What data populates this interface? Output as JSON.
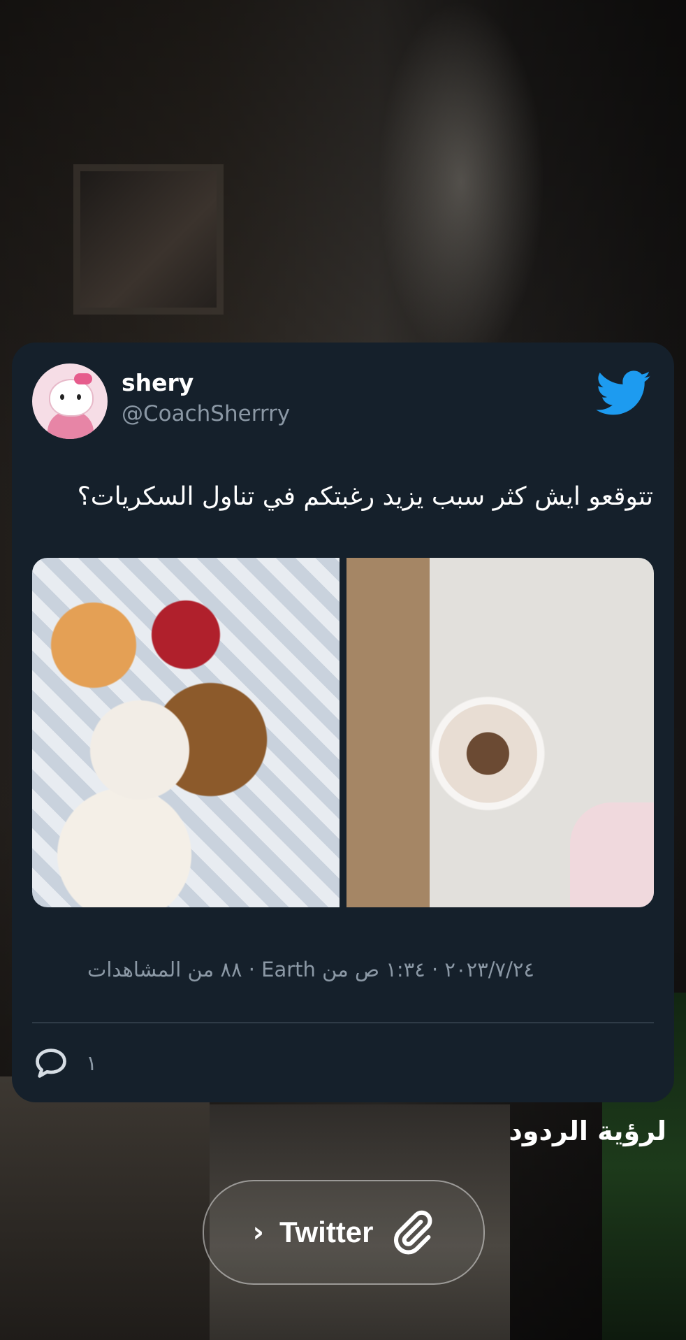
{
  "tweet": {
    "author_name": "shery",
    "author_handle": "@CoachSherrry",
    "text": "تتوقعو ايش كثر سبب يزيد رغبتكم في تناول السكريات؟",
    "meta": "٢٠٢٣/٧/٢٤ · ١:٣٤ ص من Earth · ٨٨ من المشاهدات",
    "reply_count": "١",
    "brand_icon": "twitter-bird-icon",
    "colors": {
      "card_bg": "#15202b",
      "twitter_blue": "#1d9bf0",
      "muted": "#8b98a5"
    }
  },
  "cta": {
    "see_replies": "لرؤية الردود",
    "link_label": "Twitter",
    "chevron_icon": "chevron-right-icon",
    "link_icon": "paperclip-icon"
  }
}
